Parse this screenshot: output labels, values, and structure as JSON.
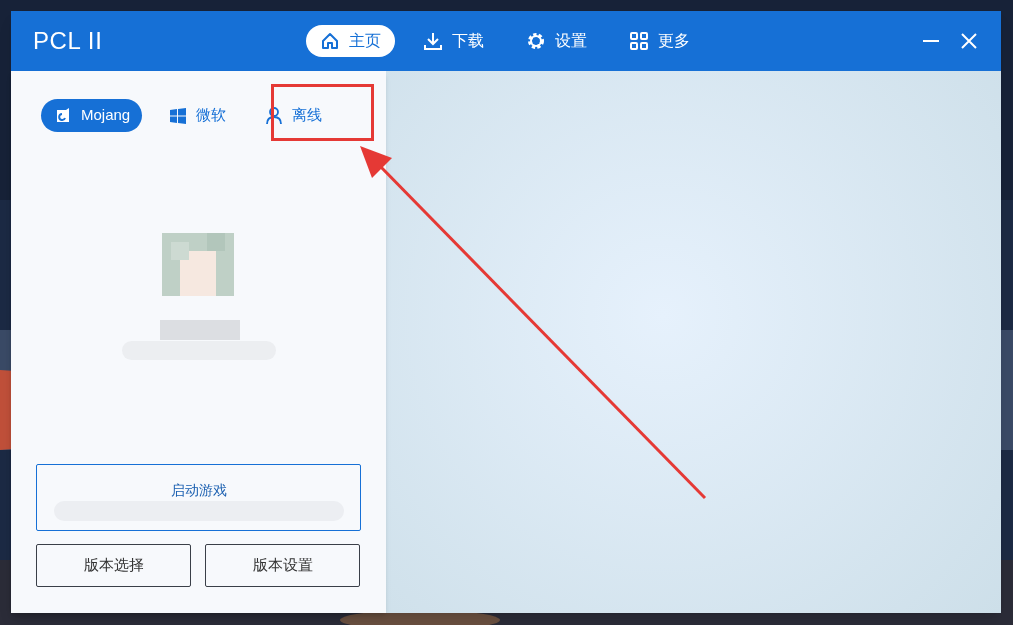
{
  "window": {
    "title": "PCL II"
  },
  "nav_tabs": [
    {
      "label": "主页",
      "selected": true
    },
    {
      "label": "下载",
      "selected": false
    },
    {
      "label": "设置",
      "selected": false
    },
    {
      "label": "更多",
      "selected": false
    }
  ],
  "login_tabs": [
    {
      "label": "Mojang",
      "selected": true
    },
    {
      "label": "微软",
      "selected": false
    },
    {
      "label": "离线",
      "selected": false
    }
  ],
  "launch_button": {
    "label": "启动游戏"
  },
  "buttons": [
    "版本选择",
    "版本设置"
  ]
}
